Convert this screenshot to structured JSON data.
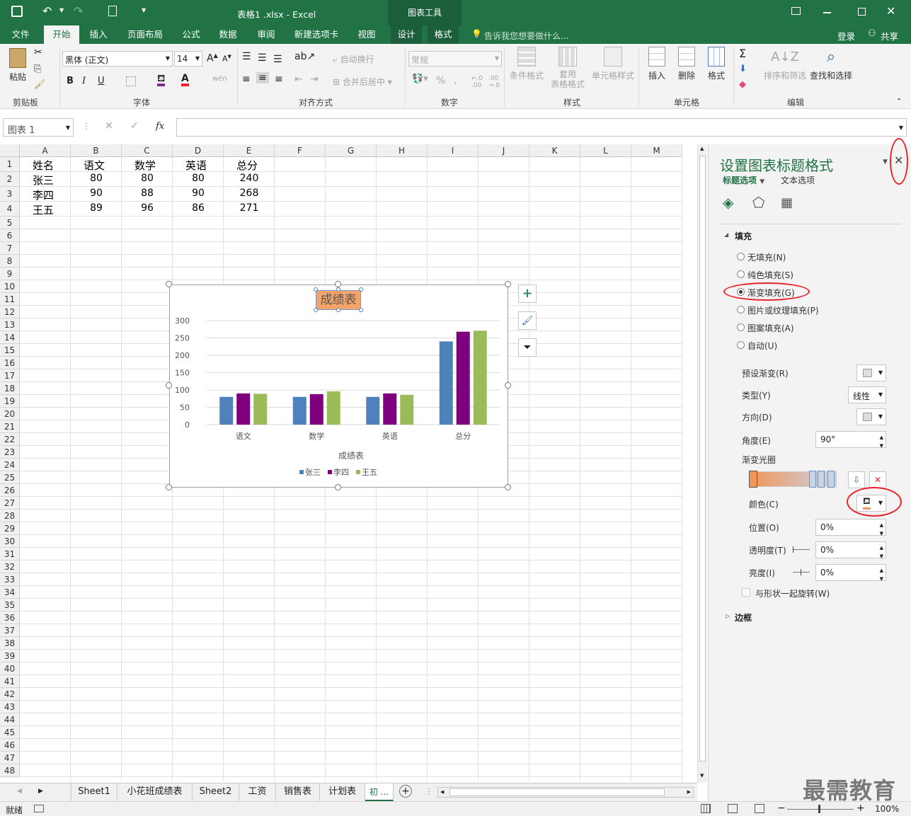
{
  "titlebar": {
    "filename": "表格1 .xlsx - Excel",
    "context_tool": "图表工具"
  },
  "tabs": [
    "文件",
    "开始",
    "插入",
    "页面布局",
    "公式",
    "数据",
    "审阅",
    "新建选项卡",
    "视图",
    "设计",
    "格式"
  ],
  "tell_me": "告诉我您想要做什么...",
  "login": "登录",
  "share": "共享",
  "ribbon": {
    "clipboard": {
      "paste": "粘贴",
      "label": "剪贴板"
    },
    "font": {
      "name": "黑体 (正文)",
      "size": "14",
      "label": "字体",
      "phonetic": "wén"
    },
    "alignment": {
      "wrap": "自动换行",
      "merge": "合并后居中",
      "label": "对齐方式"
    },
    "number": {
      "format": "常规",
      "label": "数字"
    },
    "styles": {
      "cond": "条件格式",
      "table1": "套用",
      "table2": "表格格式",
      "cell": "单元格样式",
      "label": "样式"
    },
    "cells": {
      "insert": "插入",
      "delete": "删除",
      "format": "格式",
      "label": "单元格"
    },
    "editing": {
      "sort": "排序和筛选",
      "find": "查找和选择",
      "label": "编辑"
    }
  },
  "formula": {
    "namebox": "图表 1",
    "fx": "fx",
    "value": ""
  },
  "columns": [
    "A",
    "B",
    "C",
    "D",
    "E",
    "F",
    "G",
    "H",
    "I",
    "J",
    "K",
    "L",
    "M"
  ],
  "rows": [
    "1",
    "2",
    "3",
    "4",
    "5",
    "6",
    "7",
    "8",
    "9",
    "10",
    "11",
    "12",
    "13",
    "14",
    "15",
    "16",
    "17",
    "18",
    "19",
    "20",
    "21",
    "22",
    "23",
    "24",
    "25",
    "26",
    "27",
    "28",
    "29",
    "30",
    "31",
    "32",
    "33",
    "34",
    "35",
    "36",
    "37",
    "38",
    "39",
    "40",
    "41",
    "42",
    "43",
    "44",
    "45",
    "46",
    "47",
    "48"
  ],
  "table": [
    [
      "姓名",
      "语文",
      "数学",
      "英语",
      "总分"
    ],
    [
      "张三",
      "80",
      "80",
      "80",
      "240"
    ],
    [
      "李四",
      "90",
      "88",
      "90",
      "268"
    ],
    [
      "王五",
      "89",
      "96",
      "86",
      "271"
    ]
  ],
  "chart_data": {
    "type": "bar",
    "title": "成绩表",
    "xlabel": "成绩表",
    "ylabel": "",
    "categories": [
      "语文",
      "数学",
      "英语",
      "总分"
    ],
    "series": [
      {
        "name": "张三",
        "values": [
          80,
          80,
          80,
          240
        ],
        "color": "#4f81bd"
      },
      {
        "name": "李四",
        "values": [
          90,
          88,
          90,
          268
        ],
        "color": "#7f007f"
      },
      {
        "name": "王五",
        "values": [
          89,
          96,
          86,
          271
        ],
        "color": "#9bbb59"
      }
    ],
    "ylim": [
      0,
      300
    ],
    "yticks": [
      "0",
      "50",
      "100",
      "150",
      "200",
      "250",
      "300"
    ],
    "grid": true,
    "legend": "bottom",
    "title_fill": "#f4a46a"
  },
  "sheet_tabs": [
    "Sheet1",
    "小花班成绩表",
    "Sheet2",
    "工资",
    "销售表",
    "计划表",
    "初 ..."
  ],
  "status": {
    "ready": "就绪",
    "zoom": "100%"
  },
  "pane": {
    "title": "设置图表标题格式",
    "tab_title_options": "标题选项",
    "tab_text_options": "文本选项",
    "section_fill": "填充",
    "fill_options": [
      "无填充(N)",
      "纯色填充(S)",
      "渐变填充(G)",
      "图片或纹理填充(P)",
      "图案填充(A)",
      "自动(U)"
    ],
    "selected_fill": 2,
    "preset": "预设渐变(R)",
    "type_label": "类型(Y)",
    "type_value": "线性",
    "direction": "方向(D)",
    "angle_label": "角度(E)",
    "angle_value": "90°",
    "stops_label": "渐变光圈",
    "color_label": "颜色(C)",
    "position_label": "位置(O)",
    "position_value": "0%",
    "transparency_label": "透明度(T)",
    "transparency_value": "0%",
    "brightness_label": "亮度(I)",
    "brightness_value": "0%",
    "rotate_with_shape": "与形状一起旋转(W)",
    "section_border": "边框"
  },
  "watermark": "最需教育"
}
